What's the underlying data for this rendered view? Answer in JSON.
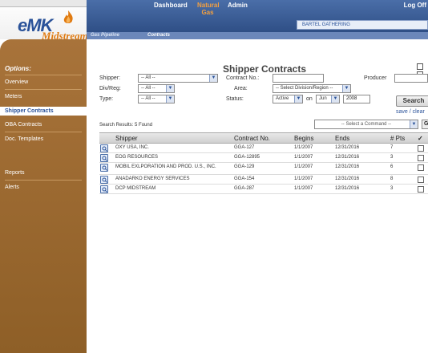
{
  "header": {
    "logo_main": "eMK",
    "logo_sub": "Midstream",
    "nav": [
      {
        "label": "Dashboard"
      },
      {
        "label": "Natural Gas"
      },
      {
        "label": "Admin"
      },
      {
        "label": "Log Off"
      }
    ],
    "facility": "BARTEL GATHERING",
    "subnav": [
      {
        "label": "Gas Pipeline"
      },
      {
        "label": "Contracts"
      }
    ]
  },
  "sidebar": {
    "title": "Options:",
    "items": [
      {
        "label": "Overview"
      },
      {
        "label": "Meters"
      },
      {
        "label": "Shipper Contracts"
      },
      {
        "label": "OBA Contracts"
      },
      {
        "label": "Doc. Templates"
      },
      {
        "label": "Reports"
      },
      {
        "label": "Alerts"
      }
    ]
  },
  "page": {
    "title": "Shipper Contracts"
  },
  "filters": {
    "shipper_label": "Shipper:",
    "shipper_value": "-- All --",
    "divreg_label": "Div/Reg:",
    "divreg_value": "-- All --",
    "type_label": "Type:",
    "type_value": "-- All --",
    "contract_label": "Contract No.:",
    "contract_value": "",
    "producer_label": "Producer",
    "area_label": "Area:",
    "area_value": "-- Select Division/Region --",
    "status_label": "Status:",
    "status_value": "Active",
    "on_label": "on",
    "month_value": "Jun",
    "year_value": "2008",
    "search_label": "Search",
    "save_label": "save / clear"
  },
  "results": {
    "label": "Search Results: 5 Found",
    "command_placeholder": "-- Select a Command --",
    "go_label": "Go"
  },
  "table": {
    "headers": {
      "shipper": "Shipper",
      "contract": "Contract No.",
      "begins": "Begins",
      "ends": "Ends",
      "pts": "# Pts",
      "check": "✓"
    },
    "rows": [
      {
        "shipper": "OXY USA, INC.",
        "contract": "GGA-127",
        "begins": "1/1/2007",
        "ends": "12/31/2016",
        "pts": "7"
      },
      {
        "shipper": "EOG RESOURCES",
        "contract": "GGA-12895",
        "begins": "1/1/2007",
        "ends": "12/31/2016",
        "pts": "3"
      },
      {
        "shipper": "MOBIL EXLPORATION AND PROD. U.S., INC.",
        "contract": "GGA-129",
        "begins": "1/1/2007",
        "ends": "12/31/2016",
        "pts": "6"
      },
      {
        "shipper": "ANADARKO ENERGY SERVICES",
        "contract": "GGA-154",
        "begins": "1/1/2007",
        "ends": "12/31/2016",
        "pts": "8"
      },
      {
        "shipper": "DCP MIDSTREAM",
        "contract": "GGA-287",
        "begins": "1/1/2007",
        "ends": "12/31/2016",
        "pts": "3"
      }
    ]
  },
  "colors": {
    "brand_blue": "#2a5299",
    "brand_orange": "#e07a10",
    "sidebar_brown": "#9e6b2e",
    "nav_active": "#f3a040"
  }
}
